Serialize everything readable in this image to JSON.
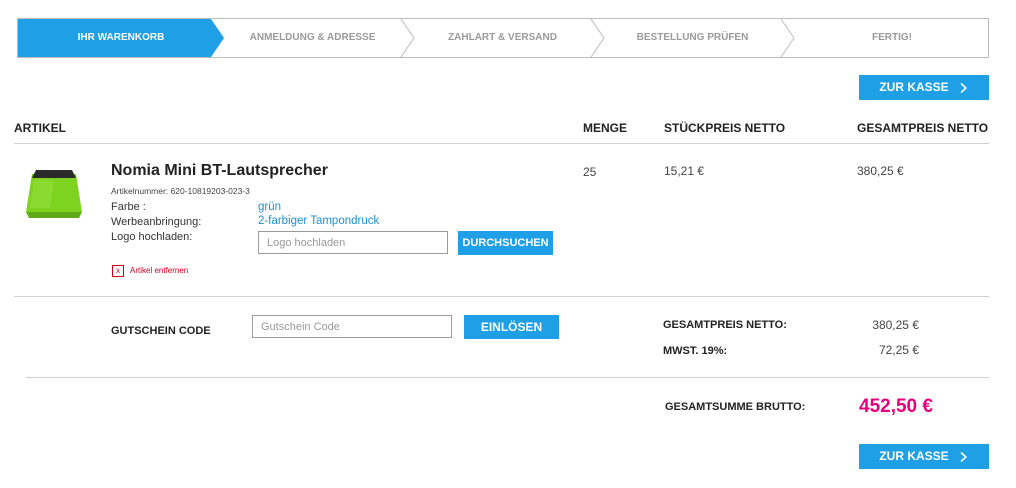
{
  "steps": [
    {
      "label": "IHR WARENKORB",
      "active": true
    },
    {
      "label": "ANMELDUNG & ADRESSE",
      "active": false
    },
    {
      "label": "ZAHLART & VERSAND",
      "active": false
    },
    {
      "label": "BESTELLUNG PRÜFEN",
      "active": false
    },
    {
      "label": "FERTIG!",
      "active": false
    }
  ],
  "checkout_label": "ZUR KASSE",
  "table_headers": {
    "article": "ARTIKEL",
    "quantity": "MENGE",
    "unit_price": "STÜCKPREIS NETTO",
    "total_price": "GESAMTPREIS NETTO"
  },
  "item": {
    "name": "Nomia Mini BT-Lautsprecher",
    "article_number": "Artikelnummer: 620-10819203-023-3",
    "color_label": "Farbe :",
    "color_value": "grün",
    "print_label": "Werbeanbringung:",
    "print_value": "2-farbiger Tampondruck",
    "logo_label": "Logo hochladen:",
    "logo_placeholder": "Logo hochladen",
    "browse_label": "DURCHSUCHEN",
    "remove_label": "Artikel entfernen",
    "quantity": "25",
    "unit_price": "15,21 €",
    "total_price": "380,25 €"
  },
  "voucher": {
    "label": "GUTSCHEIN CODE",
    "placeholder": "Gutschein Code",
    "redeem_label": "EINLÖSEN"
  },
  "totals": {
    "net_label": "GESAMTPREIS NETTO:",
    "net_value": "380,25 €",
    "vat_label": "MWST. 19%:",
    "vat_value": "72,25 €",
    "gross_label": "GESAMTSUMME BRUTTO:",
    "gross_value": "452,50 €"
  },
  "colors": {
    "accent": "#1e9fe6",
    "price_highlight": "#e6007e",
    "product_green": "#7ed321",
    "remove_red": "#d0021b"
  }
}
